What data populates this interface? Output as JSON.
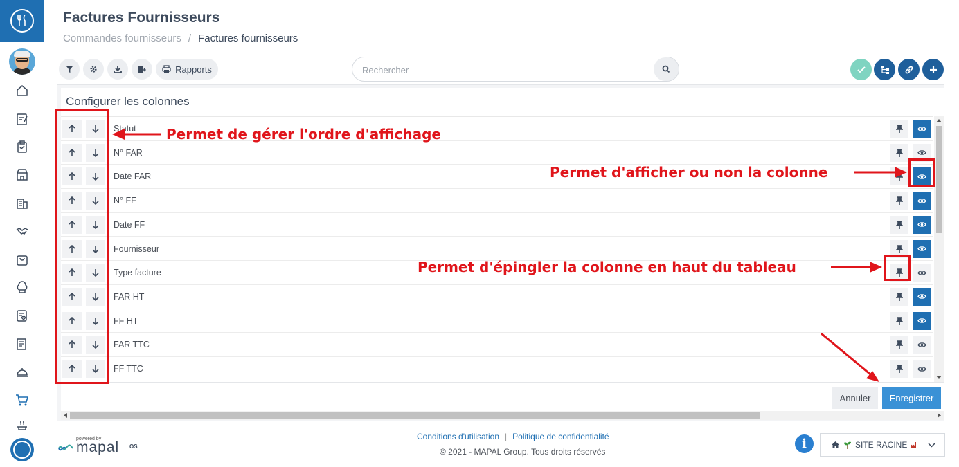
{
  "header": {
    "title": "Factures Fournisseurs",
    "breadcrumb": [
      "Commandes fournisseurs",
      "Factures fournisseurs"
    ],
    "breadcrumb_separator": "/"
  },
  "toolbar": {
    "reports_label": "Rapports",
    "icons": [
      "filter-icon",
      "gear-icon",
      "download-icon",
      "export-icon",
      "print-icon"
    ]
  },
  "search": {
    "placeholder": "Rechercher",
    "value": ""
  },
  "actions": [
    {
      "name": "validate-button",
      "icon": "check-icon",
      "color": "#7fd4c1"
    },
    {
      "name": "sitemap-button",
      "icon": "sitemap-icon",
      "color": "#1f5f9b"
    },
    {
      "name": "link-button",
      "icon": "link-icon",
      "color": "#1f5f9b"
    },
    {
      "name": "add-button",
      "icon": "plus-icon",
      "color": "#1f5f9b"
    }
  ],
  "panel": {
    "title": "Configurer les colonnes",
    "rows": [
      {
        "label": "Statut",
        "visible": true
      },
      {
        "label": "N° FAR",
        "visible": false
      },
      {
        "label": "Date FAR",
        "visible": true
      },
      {
        "label": "N° FF",
        "visible": true
      },
      {
        "label": "Date FF",
        "visible": true
      },
      {
        "label": "Fournisseur",
        "visible": true
      },
      {
        "label": "Type facture",
        "visible": false
      },
      {
        "label": "FAR HT",
        "visible": true
      },
      {
        "label": "FF HT",
        "visible": true
      },
      {
        "label": "FAR TTC",
        "visible": false
      },
      {
        "label": "FF TTC",
        "visible": false
      }
    ],
    "cancel_label": "Annuler",
    "save_label": "Enregistrer"
  },
  "annotations": {
    "order": "Permet de gérer l'ordre d'affichage",
    "visibility": "Permet d'afficher ou non la colonne",
    "pin": "Permet d'épingler la colonne en haut du tableau",
    "color": "#e0151b"
  },
  "footer": {
    "powered_by": "powered by",
    "brand": "mapal",
    "brand_suffix": "OS",
    "terms": "Conditions d'utilisation",
    "privacy": "Politique de confidentialité",
    "link_separator": "|",
    "copyright": "© 2021 - MAPAL Group. Tous droits réservés",
    "site_label": "SITE RACINE"
  },
  "colors": {
    "brand": "#1f6fb2",
    "primary_button": "#3a91d6"
  },
  "sidebar_icons": [
    "home-icon",
    "edit-icon",
    "clipboard-icon",
    "store-icon",
    "building-icon",
    "handshake-icon",
    "bag-icon",
    "chef-hat-icon",
    "checklist-heart-icon",
    "report-icon",
    "cloche-icon",
    "cart-icon",
    "cooking-icon"
  ]
}
